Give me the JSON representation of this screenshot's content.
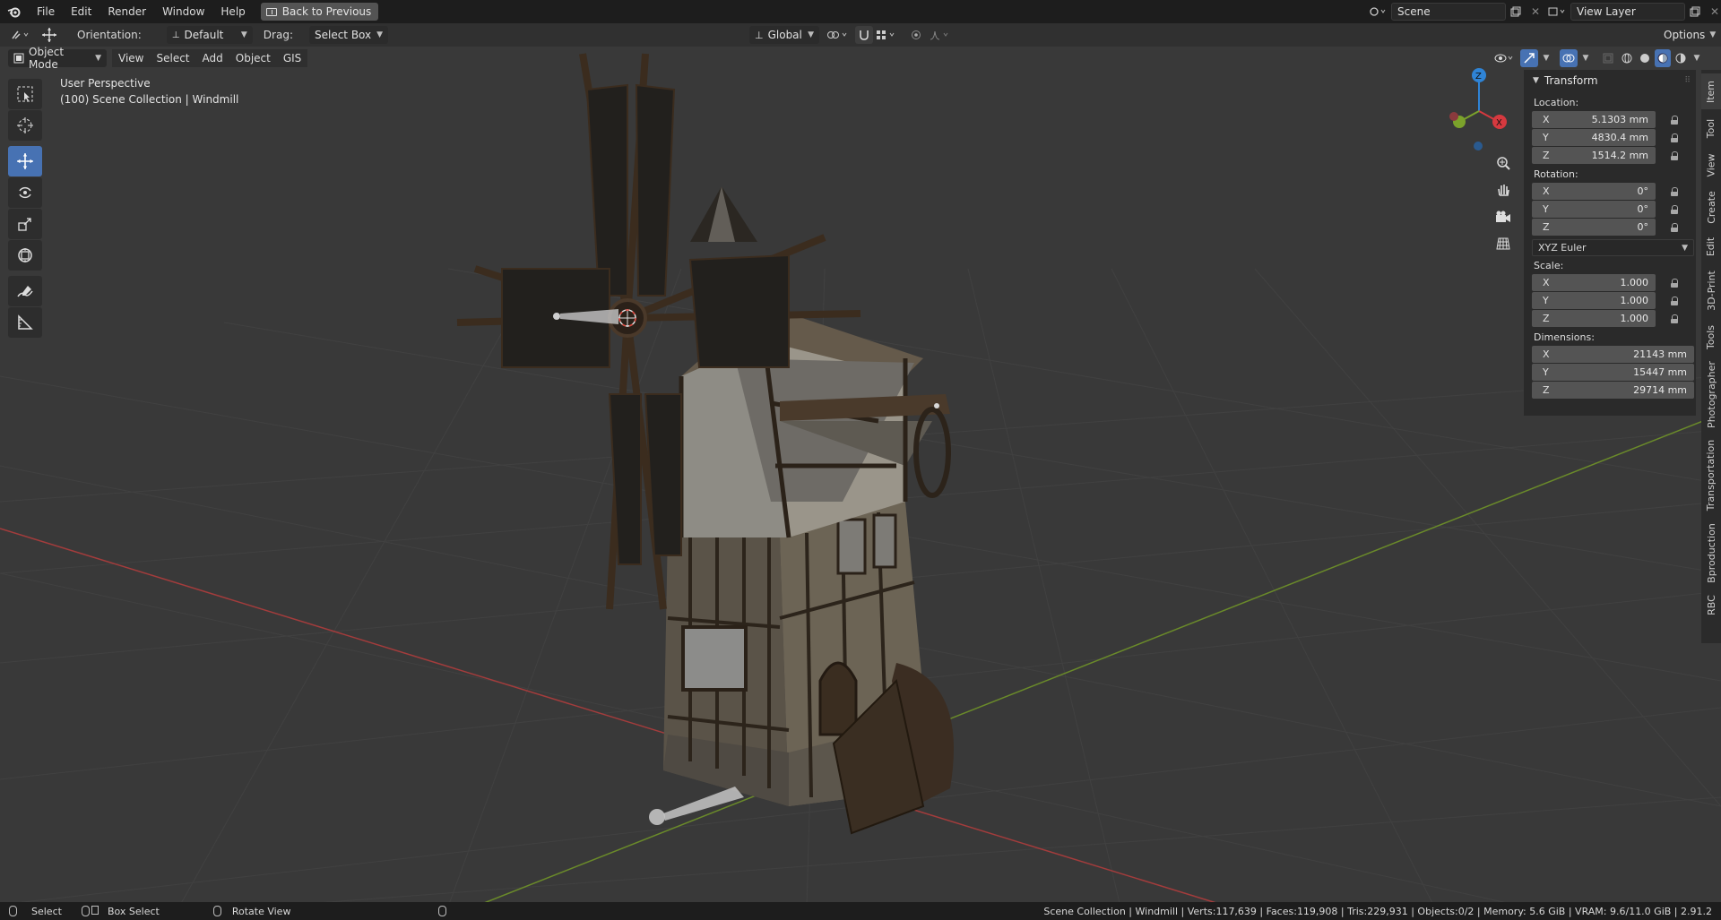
{
  "topbar": {
    "menus": [
      "File",
      "Edit",
      "Render",
      "Window",
      "Help"
    ],
    "back_button": "Back to Previous",
    "scene_name": "Scene",
    "view_layer": "View Layer"
  },
  "header": {
    "orientation_label": "Orientation:",
    "orientation_value": "Default",
    "drag_label": "Drag:",
    "drag_value": "Select Box",
    "transform_orientation": "Global",
    "options": "Options"
  },
  "viewport_header": {
    "mode": "Object Mode",
    "menus": [
      "View",
      "Select",
      "Add",
      "Object",
      "GIS"
    ]
  },
  "viewport": {
    "perspective": "User Perspective",
    "collection": "(100) Scene Collection | Windmill"
  },
  "gizmo": {
    "z": "Z",
    "x": "X"
  },
  "npanel": {
    "title": "Transform",
    "location_label": "Location:",
    "location": [
      {
        "axis": "X",
        "value": "5.1303 mm"
      },
      {
        "axis": "Y",
        "value": "4830.4 mm"
      },
      {
        "axis": "Z",
        "value": "1514.2 mm"
      }
    ],
    "rotation_label": "Rotation:",
    "rotation": [
      {
        "axis": "X",
        "value": "0°"
      },
      {
        "axis": "Y",
        "value": "0°"
      },
      {
        "axis": "Z",
        "value": "0°"
      }
    ],
    "rotation_mode": "XYZ Euler",
    "scale_label": "Scale:",
    "scale": [
      {
        "axis": "X",
        "value": "1.000"
      },
      {
        "axis": "Y",
        "value": "1.000"
      },
      {
        "axis": "Z",
        "value": "1.000"
      }
    ],
    "dimensions_label": "Dimensions:",
    "dimensions": [
      {
        "axis": "X",
        "value": "21143 mm"
      },
      {
        "axis": "Y",
        "value": "15447 mm"
      },
      {
        "axis": "Z",
        "value": "29714 mm"
      }
    ]
  },
  "tabs": [
    "Item",
    "Tool",
    "View",
    "Create",
    "Edit",
    "3D-Print",
    "Tools",
    "Photographer",
    "Transportation",
    "Bproduction",
    "RBC"
  ],
  "status": {
    "select": "Select",
    "box_select": "Box Select",
    "rotate_view": "Rotate View",
    "stats": "Scene Collection | Windmill | Verts:117,639 | Faces:119,908 | Tris:229,931 | Objects:0/2 | Memory: 5.6 GiB | VRAM: 9.6/11.0 GiB | 2.91.2"
  },
  "colors": {
    "accent": "#4772b3",
    "x_axis": "#d6393f",
    "y_axis": "#7ba22b",
    "z_axis": "#2f84d6"
  }
}
